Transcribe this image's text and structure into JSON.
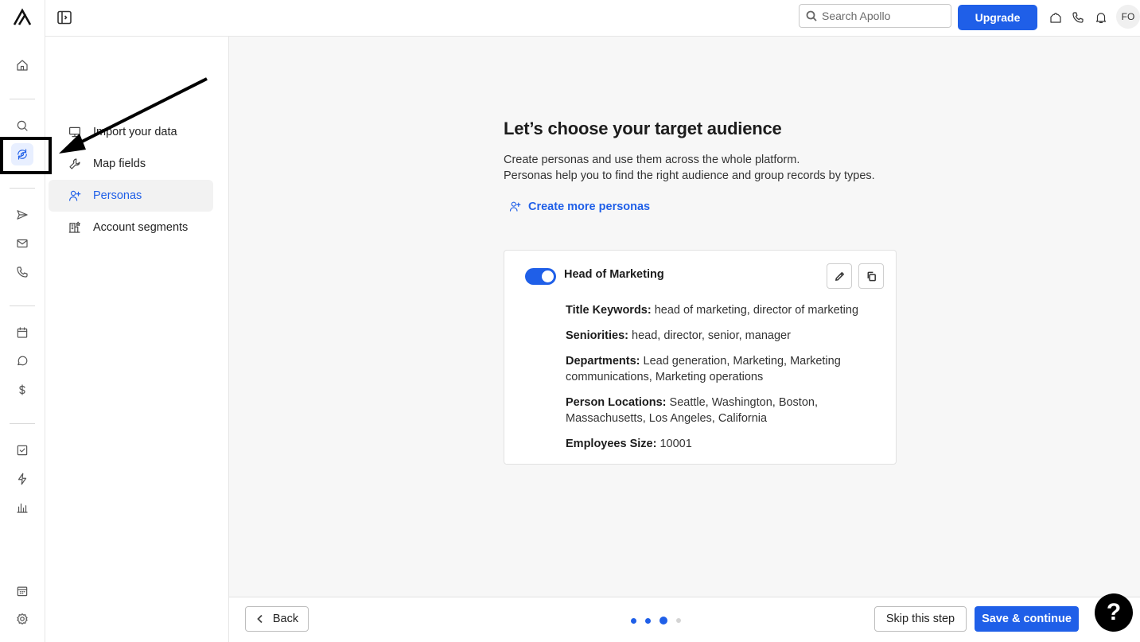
{
  "topbar": {
    "search_placeholder": "Search Apollo",
    "upgrade_label": "Upgrade",
    "avatar_initials": "FO"
  },
  "subnav": {
    "items": [
      {
        "label": "Import your data",
        "icon": "monitor-icon"
      },
      {
        "label": "Map fields",
        "icon": "wrench-icon"
      },
      {
        "label": "Personas",
        "icon": "user-plus-icon",
        "active": true
      },
      {
        "label": "Account segments",
        "icon": "building-star-icon"
      }
    ]
  },
  "main": {
    "title": "Let’s choose your target audience",
    "description_line1": "Create personas and use them across the whole platform.",
    "description_line2": "Personas help you to find the right audience and group records by types.",
    "create_link": "Create more personas",
    "persona": {
      "enabled": true,
      "name": "Head of Marketing",
      "fields": [
        {
          "label": "Title Keywords:",
          "value": "head of marketing, director of marketing"
        },
        {
          "label": "Seniorities:",
          "value": "head, director, senior, manager"
        },
        {
          "label": "Departments:",
          "value": "Lead generation, Marketing, Marketing communications, Marketing operations"
        },
        {
          "label": "Person Locations:",
          "value": "Seattle, Washington, Boston, Massachusetts, Los Angeles, California"
        },
        {
          "label": "Employees Size:",
          "value": "10001"
        }
      ]
    }
  },
  "footer": {
    "back_label": "Back",
    "skip_label": "Skip this step",
    "save_label": "Save & continue",
    "step_current": 3,
    "step_total": 4
  },
  "help": {
    "label": "?"
  },
  "colors": {
    "accent": "#1f5fe8",
    "background": "#f7f7f7"
  }
}
